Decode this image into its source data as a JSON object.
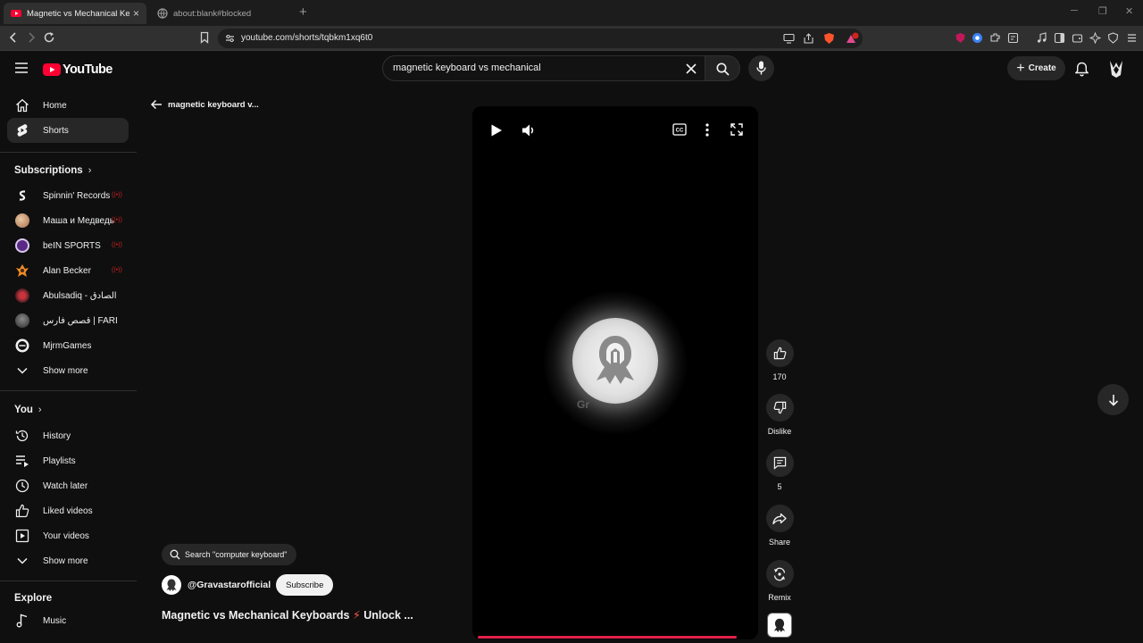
{
  "browser": {
    "tabs": [
      {
        "title": "Magnetic vs Mechanical Keyboards"
      },
      {
        "title": "about:blank#blocked"
      }
    ],
    "url": "youtube.com/shorts/tqbkm1xq6t0",
    "new_tab_label": "+",
    "window_controls": {
      "minimize": "─",
      "restore": "❐",
      "close": "✕"
    }
  },
  "masthead": {
    "logo_text": "YouTube",
    "search_query": "magnetic keyboard vs mechanical",
    "create_label": "Create"
  },
  "sidebar": {
    "main": [
      {
        "label": "Home"
      },
      {
        "label": "Shorts"
      }
    ],
    "subscriptions_title": "Subscriptions",
    "subscriptions": [
      {
        "label": "Spinnin' Records"
      },
      {
        "label": "Маша и Медведь"
      },
      {
        "label": "beIN SPORTS"
      },
      {
        "label": "Alan Becker"
      },
      {
        "label": "Abulsadiq - ابو الصادق"
      },
      {
        "label": "قصص فارس | FARIS S..."
      },
      {
        "label": "MjrmGames"
      },
      {
        "label": "Show more"
      }
    ],
    "you_title": "You",
    "you": [
      {
        "label": "History"
      },
      {
        "label": "Playlists"
      },
      {
        "label": "Watch later"
      },
      {
        "label": "Liked videos"
      },
      {
        "label": "Your videos"
      },
      {
        "label": "Show more"
      }
    ],
    "explore_title": "Explore",
    "explore": [
      {
        "label": "Music"
      }
    ]
  },
  "content": {
    "back_label": "magnetic keyboard v...",
    "watermark": "Gr",
    "search_pill": "Search \"computer keyboard\"",
    "channel_handle": "@Gravastarofficial",
    "subscribe_label": "Subscribe",
    "video_title": "Magnetic vs Mechanical Keyboards",
    "video_title_tail": "Unlock ...",
    "video_title_emoji": "⚡"
  },
  "actions": {
    "likes": "170",
    "dislike_label": "Dislike",
    "comments": "5",
    "share_label": "Share",
    "remix_label": "Remix"
  },
  "colors": {
    "background": "#0f0f0f",
    "brand_red": "#ff0033",
    "progress": "#e0204a",
    "chip": "#272727"
  }
}
